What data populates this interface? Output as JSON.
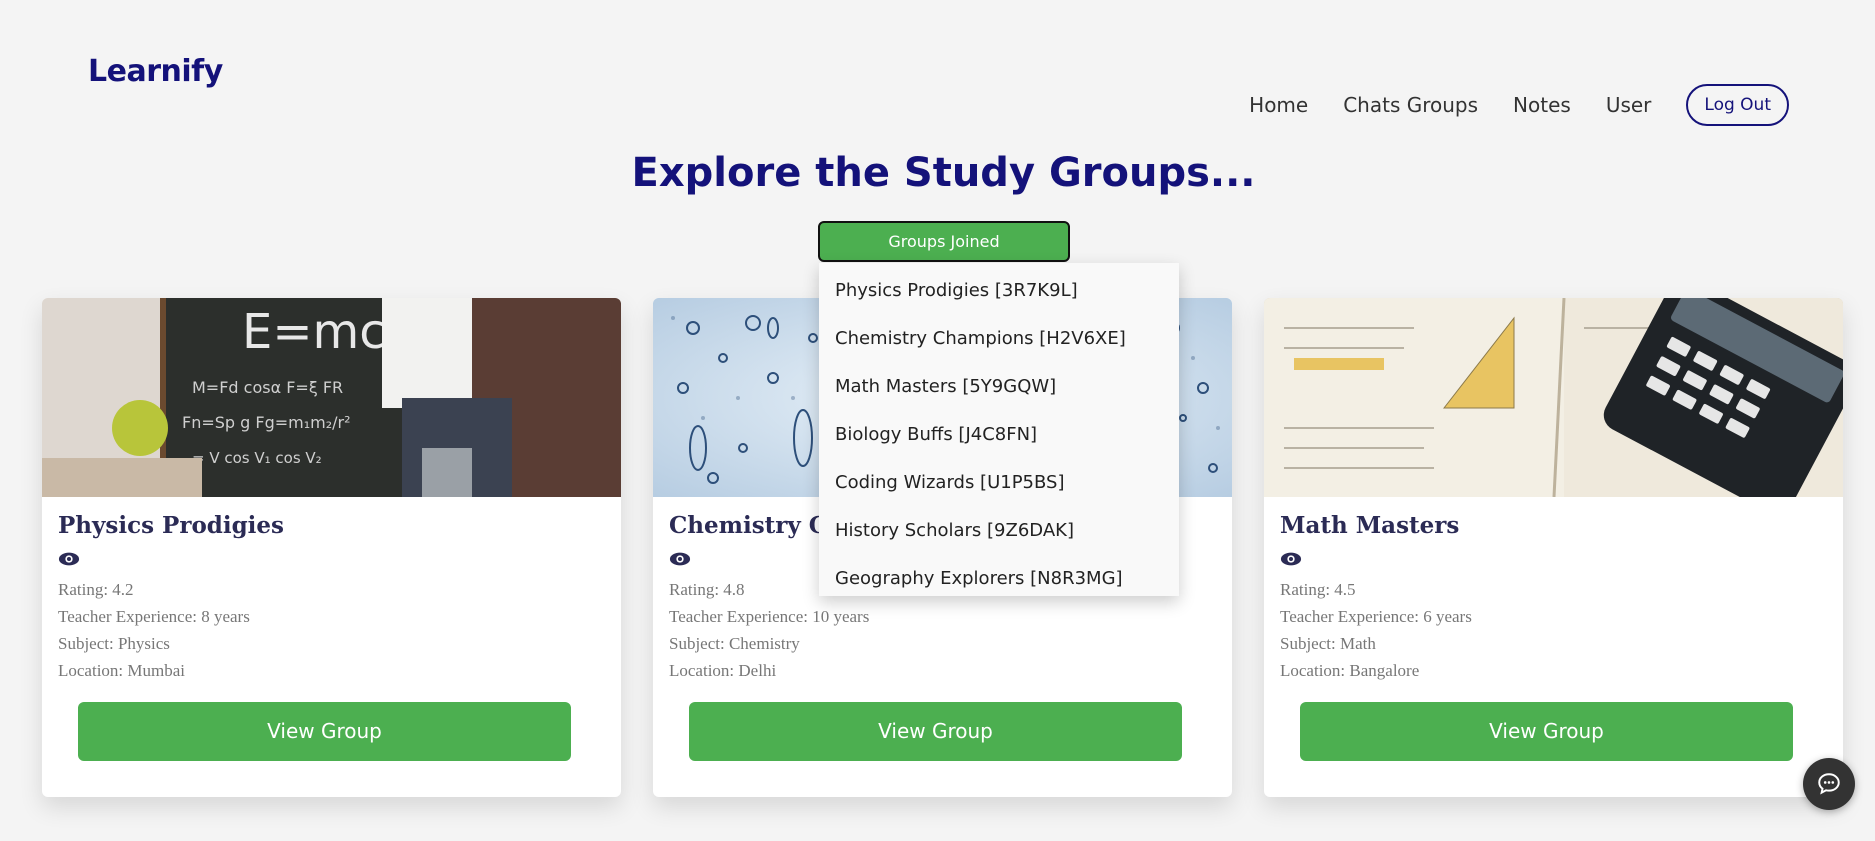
{
  "brand": "Learnify",
  "nav": {
    "items": [
      "Home",
      "Chats Groups",
      "Notes",
      "User"
    ],
    "logout": "Log Out"
  },
  "page_title": "Explore the Study Groups...",
  "groups_joined": {
    "label": "Groups Joined",
    "items": [
      "Physics Prodigies [3R7K9L]",
      "Chemistry Champions [H2V6XE]",
      "Math Masters [5Y9GQW]",
      "Biology Buffs [J4C8FN]",
      "Coding Wizards [U1P5BS]",
      "History Scholars [9Z6DAK]",
      "Geography Explorers [N8R3MG]"
    ]
  },
  "cards": [
    {
      "name": "Physics Prodigies",
      "rating": "Rating: 4.2",
      "experience": "Teacher Experience: 8 years",
      "subject": "Subject: Physics",
      "location": "Location: Mumbai",
      "button": "View Group",
      "photo_text": "E=mc²"
    },
    {
      "name": "Chemistry Champions",
      "rating": "Rating: 4.8",
      "experience": "Teacher Experience: 10 years",
      "subject": "Subject: Chemistry",
      "location": "Location: Delhi",
      "button": "View Group"
    },
    {
      "name": "Math Masters",
      "rating": "Rating: 4.5",
      "experience": "Teacher Experience: 6 years",
      "subject": "Subject: Math",
      "location": "Location: Bangalore",
      "button": "View Group"
    }
  ],
  "colors": {
    "brand": "#14127a",
    "button_green": "#4caf50",
    "background": "#f4f4f4"
  },
  "icons": {
    "card": "eye-icon",
    "fab": "chat-bubble-icon"
  }
}
